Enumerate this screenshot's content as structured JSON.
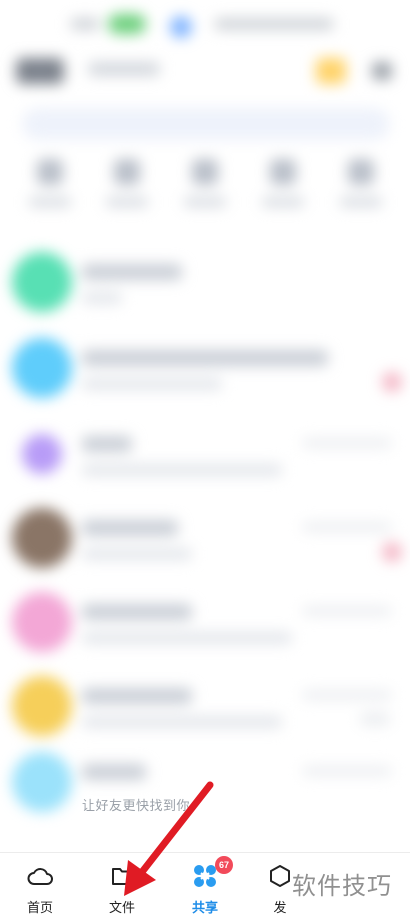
{
  "hint": {
    "text": "让好友更快找到你"
  },
  "bottom_nav": {
    "items": [
      {
        "label": "首页",
        "icon": "cloud-icon"
      },
      {
        "label": "文件",
        "icon": "folder-icon"
      },
      {
        "label": "共享",
        "icon": "share-icon",
        "active": true,
        "badge": "67"
      },
      {
        "label": "发",
        "icon": "discover-icon"
      }
    ]
  },
  "colors": {
    "accent": "#1f8de8",
    "badge": "#f24a5a",
    "arrow": "#e01b24"
  },
  "watermark": {
    "text": "软件技巧"
  }
}
